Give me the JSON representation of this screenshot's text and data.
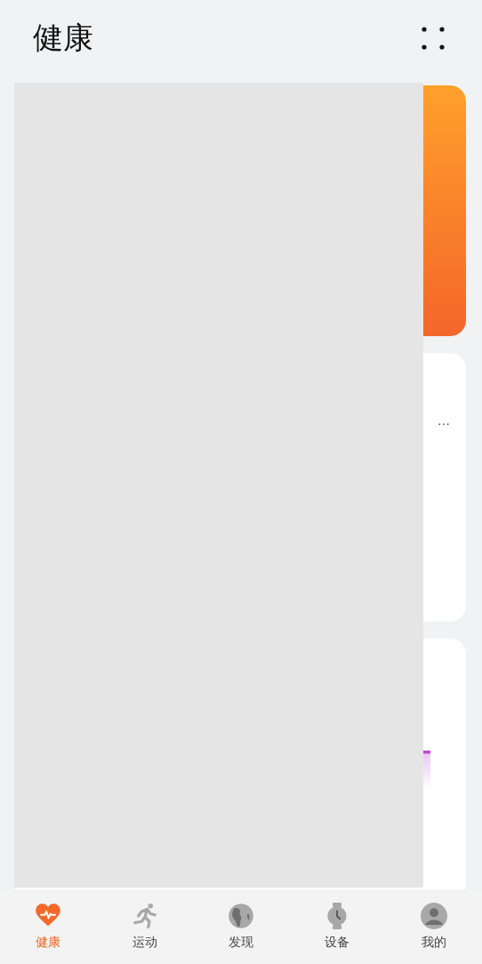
{
  "header": {
    "title": "健康"
  },
  "cards": [
    {
      "kind": "banner"
    },
    {
      "kind": "text",
      "text": "…"
    },
    {
      "kind": "chart"
    }
  ],
  "tabs": [
    {
      "label": "健康",
      "selected": true
    },
    {
      "label": "运动",
      "selected": false
    },
    {
      "label": "发现",
      "selected": false
    },
    {
      "label": "设备",
      "selected": false
    },
    {
      "label": "我的",
      "selected": false
    }
  ]
}
